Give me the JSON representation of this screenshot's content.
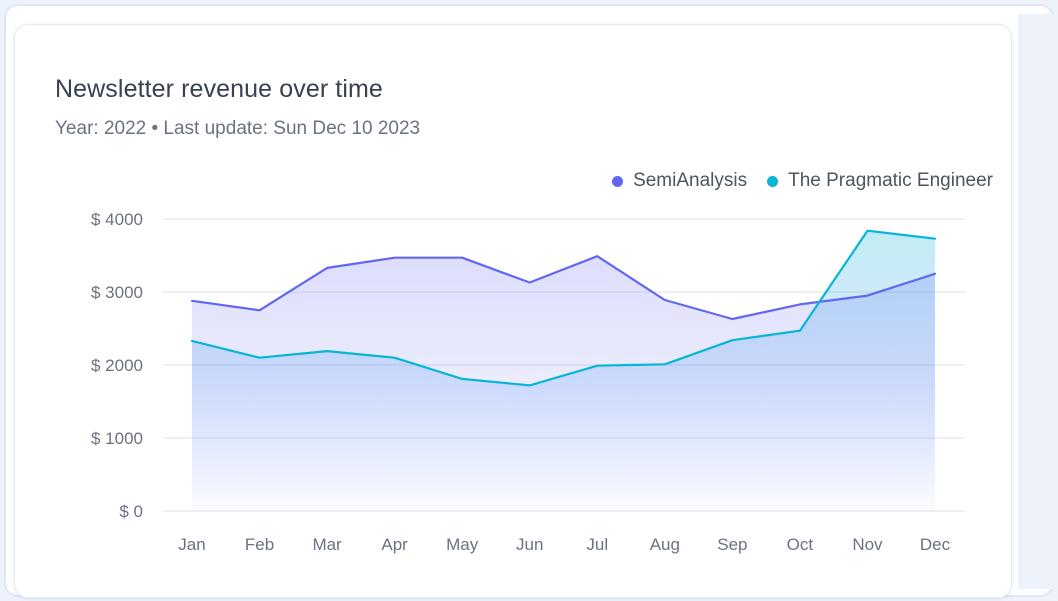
{
  "card": {
    "title": "Newsletter revenue over time",
    "subtitle": "Year: 2022 • Last update: Sun Dec 10 2023"
  },
  "colors": {
    "series_a": "#6366f1",
    "series_b": "#06b6d4",
    "grid": "#e5e7eb",
    "axis_text": "#6b7280"
  },
  "chart_data": {
    "type": "area",
    "title": "Newsletter revenue over time",
    "categories": [
      "Jan",
      "Feb",
      "Mar",
      "Apr",
      "May",
      "Jun",
      "Jul",
      "Aug",
      "Sep",
      "Oct",
      "Nov",
      "Dec"
    ],
    "series": [
      {
        "name": "SemiAnalysis",
        "color": "#6366f1",
        "values": [
          2880,
          2750,
          3330,
          3470,
          3470,
          3130,
          3490,
          2890,
          2630,
          2830,
          2950,
          3250
        ]
      },
      {
        "name": "The Pragmatic Engineer",
        "color": "#06b6d4",
        "values": [
          2330,
          2100,
          2190,
          2100,
          1810,
          1720,
          1990,
          2010,
          2340,
          2470,
          3840,
          3730
        ]
      }
    ],
    "y_ticks": [
      "$ 0",
      "$ 1000",
      "$ 2000",
      "$ 3000",
      "$ 4000"
    ],
    "y_tick_values": [
      0,
      1000,
      2000,
      3000,
      4000
    ],
    "ylim": [
      0,
      4000
    ],
    "grid": true,
    "legend": "top-right"
  }
}
